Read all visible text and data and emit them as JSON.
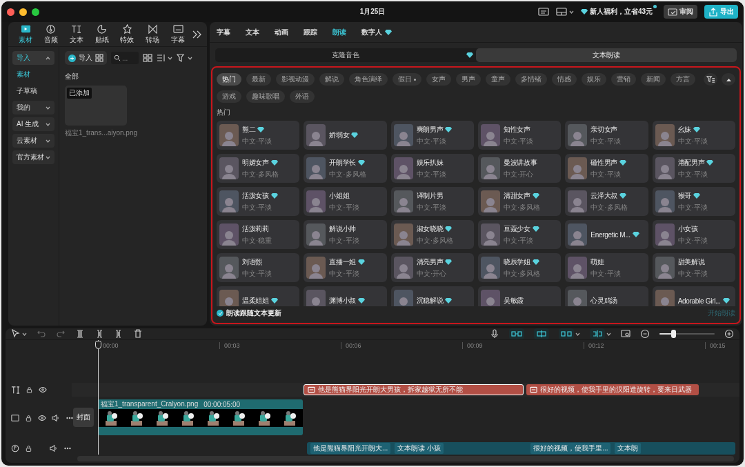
{
  "window": {
    "title": "1月25日"
  },
  "topbar": {
    "promo": "新人福利，立省43元",
    "review_button": "审阅",
    "export_button": "导出"
  },
  "media_tabs": [
    {
      "label": "素材",
      "selected": true
    },
    {
      "label": "音频",
      "selected": false
    },
    {
      "label": "文本",
      "selected": false
    },
    {
      "label": "贴纸",
      "selected": false
    },
    {
      "label": "特效",
      "selected": false
    },
    {
      "label": "转场",
      "selected": false
    },
    {
      "label": "字幕",
      "selected": false
    }
  ],
  "media_sidebar": [
    {
      "label": "导入",
      "kind": "group",
      "expanded": true,
      "selected": true
    },
    {
      "label": "素材",
      "kind": "link",
      "selected": true
    },
    {
      "label": "子草稿",
      "kind": "link",
      "selected": false
    },
    {
      "label": "我的",
      "kind": "group",
      "expanded": false,
      "selected": false
    },
    {
      "label": "AI 生成",
      "kind": "group",
      "expanded": false,
      "selected": false
    },
    {
      "label": "云素材",
      "kind": "group",
      "expanded": false,
      "selected": false
    },
    {
      "label": "官方素材",
      "kind": "group",
      "expanded": false,
      "selected": false
    }
  ],
  "media_toolbar": {
    "import_button": "导入",
    "search_placeholder": "..."
  },
  "media": {
    "section": "全部",
    "items": [
      {
        "badge": "已添加",
        "name": "福宝1_trans...aiyon.png"
      }
    ]
  },
  "editor_tabs": [
    {
      "label": "字幕",
      "selected": false,
      "premium": false
    },
    {
      "label": "文本",
      "selected": false,
      "premium": false
    },
    {
      "label": "动画",
      "selected": false,
      "premium": false
    },
    {
      "label": "跟踪",
      "selected": false,
      "premium": false
    },
    {
      "label": "朗读",
      "selected": true,
      "premium": false
    },
    {
      "label": "数字人",
      "selected": false,
      "premium": true
    }
  ],
  "read_modes": [
    {
      "label": "克隆音色",
      "selected": false,
      "premium": true
    },
    {
      "label": "文本朗读",
      "selected": true,
      "premium": false
    }
  ],
  "filters": [
    {
      "label": "热门",
      "selected": true,
      "dot": false
    },
    {
      "label": "最新",
      "selected": false,
      "dot": false
    },
    {
      "label": "影视动漫",
      "selected": false,
      "dot": false
    },
    {
      "label": "解说",
      "selected": false,
      "dot": false
    },
    {
      "label": "角色演绎",
      "selected": false,
      "dot": false
    },
    {
      "label": "假日",
      "selected": false,
      "dot": true
    },
    {
      "label": "女声",
      "selected": false,
      "dot": false
    },
    {
      "label": "男声",
      "selected": false,
      "dot": false
    },
    {
      "label": "童声",
      "selected": false,
      "dot": false
    },
    {
      "label": "多情绪",
      "selected": false,
      "dot": false
    },
    {
      "label": "情感",
      "selected": false,
      "dot": false
    },
    {
      "label": "娱乐",
      "selected": false,
      "dot": false
    },
    {
      "label": "营销",
      "selected": false,
      "dot": false
    },
    {
      "label": "新闻",
      "selected": false,
      "dot": false
    },
    {
      "label": "方言",
      "selected": false,
      "dot": false
    },
    {
      "label": "游戏",
      "selected": false,
      "dot": false
    },
    {
      "label": "趣味歌唱",
      "selected": false,
      "dot": false
    },
    {
      "label": "外语",
      "selected": false,
      "dot": false
    }
  ],
  "section_label": "热门",
  "voices": [
    {
      "name": "熊二",
      "style": "中文·平淡",
      "premium": true
    },
    {
      "name": "娇弱女",
      "premium": true
    },
    {
      "name": "爽朗男声",
      "style": "中文·平淡",
      "premium": true
    },
    {
      "name": "知性女声",
      "style": "中文·平淡",
      "premium": false
    },
    {
      "name": "亲切女声",
      "style": "中文·平淡",
      "premium": false
    },
    {
      "name": "幺妹",
      "style": "中文·平淡",
      "premium": true
    },
    {
      "name": "明媚女声",
      "style": "中文·多风格",
      "premium": true
    },
    {
      "name": "开朗学长",
      "style": "中文·多风格",
      "premium": true
    },
    {
      "name": "娱乐扒妹",
      "style": "中文·平淡",
      "premium": false
    },
    {
      "name": "曼波讲故事",
      "style": "中文·开心",
      "premium": false
    },
    {
      "name": "磁性男声",
      "style": "中文·平淡",
      "premium": true
    },
    {
      "name": "港配男声",
      "style": "中文·平淡",
      "premium": true
    },
    {
      "name": "活泼女孩",
      "style": "中文·平淡",
      "premium": true
    },
    {
      "name": "小姐姐",
      "style": "中文·平淡",
      "premium": false
    },
    {
      "name": "译制片男",
      "style": "中文·平淡",
      "premium": false
    },
    {
      "name": "清甜女声",
      "style": "中文·多风格",
      "premium": true
    },
    {
      "name": "云泽大叔",
      "style": "中文·多风格",
      "premium": true
    },
    {
      "name": "猴哥",
      "style": "中文·平淡",
      "premium": true
    },
    {
      "name": "活泼莉莉",
      "style": "中文·稳重",
      "premium": false
    },
    {
      "name": "解说小帅",
      "style": "中文·平淡",
      "premium": false
    },
    {
      "name": "淑女晓晓",
      "style": "中文·多风格",
      "premium": true
    },
    {
      "name": "豆蔻少女",
      "style": "中文·平淡",
      "premium": true
    },
    {
      "name": "Energetic M...",
      "premium": true
    },
    {
      "name": "小女孩",
      "style": "中文·平淡",
      "premium": false
    },
    {
      "name": "刘语熙",
      "style": "中文·平淡",
      "premium": false
    },
    {
      "name": "直播一姐",
      "style": "中文·平淡",
      "premium": true
    },
    {
      "name": "清亮男声",
      "style": "中文·开心",
      "premium": true
    },
    {
      "name": "晓辰学姐",
      "style": "中文·多风格",
      "premium": true
    },
    {
      "name": "萌娃",
      "style": "中文·平淡",
      "premium": false
    },
    {
      "name": "甜美解说",
      "style": "中文·平淡",
      "premium": false
    },
    {
      "name": "温柔姐姐",
      "premium": true
    },
    {
      "name": "渊博小叔",
      "premium": true
    },
    {
      "name": "沉稳解说",
      "premium": true
    },
    {
      "name": "吴敏霞",
      "premium": false
    },
    {
      "name": "心灵鸡汤",
      "premium": false
    },
    {
      "name": "Adorable Girl...",
      "premium": true
    }
  ],
  "follow_text": {
    "label": "朗读跟随文本更新",
    "checked": true
  },
  "start_button": {
    "label": "开始朗读",
    "disabled": true
  },
  "timeline": {
    "ruler": [
      "00:00",
      "00:03",
      "00:06",
      "00:09",
      "00:12",
      "00:15"
    ],
    "zoom": {
      "level": 0.25
    },
    "cover_button": "封面",
    "text_clips": [
      {
        "text": "他是熊猫界阳光开朗大男孩，拆家越狱无所不能",
        "selected": true
      },
      {
        "text": "很好的视频，使我手里的汉阳造旋转，要来日武器",
        "selected": false
      }
    ],
    "video_clip": {
      "name": "福宝1_transparent_Cralyon.png",
      "duration": "00:00:05:00"
    },
    "audio_labels": [
      "他是熊猫界阳光开朗大...",
      "文本朗读 小孩",
      "很好的视频，使我手里...",
      "文本朗"
    ]
  }
}
